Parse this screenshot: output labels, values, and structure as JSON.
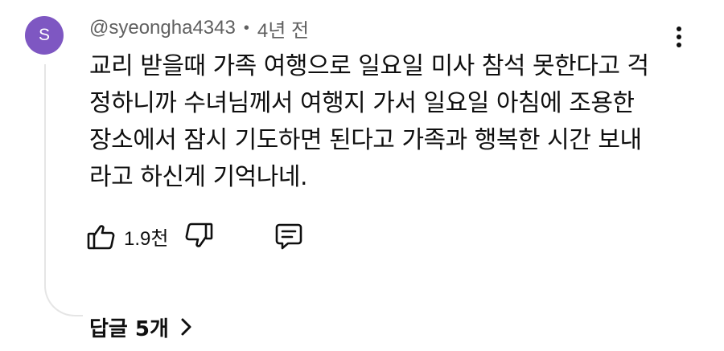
{
  "comment": {
    "avatar_initial": "S",
    "avatar_color": "#7e57c2",
    "author": "@syeongha4343",
    "separator": "•",
    "time": "4년 전",
    "text": "교리 받을때 가족 여행으로 일요일 미사 참석 못한다고 걱\n정하니까 수녀님께서 여행지 가서 일요일 아침에 조용한\n장소에서 잠시 기도하면 된다고 가족과 행복한 시간 보내\n라고 하신게 기억나네.",
    "like_count": "1.9천",
    "replies_label": "답글 5개"
  },
  "icons": {
    "like": "thumbs-up-icon",
    "dislike": "thumbs-down-icon",
    "reply": "comment-icon",
    "more": "more-vertical-icon",
    "expand": "chevron-right-icon"
  }
}
